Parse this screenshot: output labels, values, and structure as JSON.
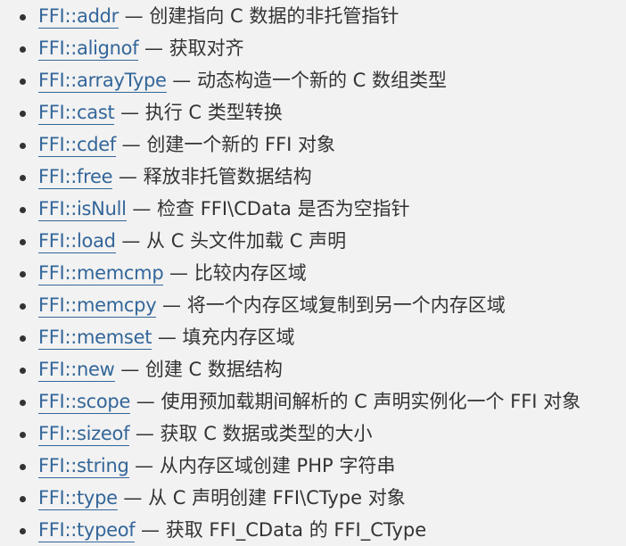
{
  "items": [
    {
      "link": "FFI::addr",
      "desc": " — 创建指向 C 数据的非托管指针"
    },
    {
      "link": "FFI::alignof",
      "desc": " — 获取对齐"
    },
    {
      "link": "FFI::arrayType",
      "desc": " — 动态构造一个新的 C 数组类型"
    },
    {
      "link": "FFI::cast",
      "desc": " — 执行 C 类型转换"
    },
    {
      "link": "FFI::cdef",
      "desc": " — 创建一个新的 FFI 对象"
    },
    {
      "link": "FFI::free",
      "desc": " — 释放非托管数据结构"
    },
    {
      "link": "FFI::isNull",
      "desc": " — 检查 FFI\\CData 是否为空指针"
    },
    {
      "link": "FFI::load",
      "desc": " — 从 C 头文件加载 C 声明"
    },
    {
      "link": "FFI::memcmp",
      "desc": " — 比较内存区域"
    },
    {
      "link": "FFI::memcpy",
      "desc": " — 将一个内存区域复制到另一个内存区域"
    },
    {
      "link": "FFI::memset",
      "desc": " — 填充内存区域"
    },
    {
      "link": "FFI::new",
      "desc": " — 创建 C 数据结构"
    },
    {
      "link": "FFI::scope",
      "desc": " — 使用预加载期间解析的 C 声明实例化一个 FFI 对象"
    },
    {
      "link": "FFI::sizeof",
      "desc": " — 获取 C 数据或类型的大小"
    },
    {
      "link": "FFI::string",
      "desc": " — 从内存区域创建 PHP 字符串"
    },
    {
      "link": "FFI::type",
      "desc": " — 从 C 声明创建 FFI\\CType 对象"
    },
    {
      "link": "FFI::typeof",
      "desc": " — 获取 FFI_CData 的 FFI_CType"
    }
  ]
}
